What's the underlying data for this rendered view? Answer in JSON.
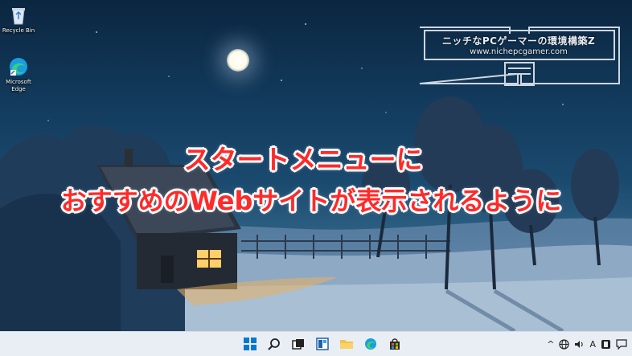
{
  "desktop": {
    "icons": [
      {
        "label": "Recycle Bin"
      },
      {
        "label": "Microsoft Edge"
      }
    ]
  },
  "overlay": {
    "line1": "スタートメニューに",
    "line2": "おすすめのWebサイトが表示されるように"
  },
  "watermark": {
    "title": "ニッチなPCゲーマーの環境構築Z",
    "url": "www.nichepcgamer.com"
  },
  "taskbar": {
    "pinned": [
      "start-icon",
      "search-icon",
      "task-view-icon",
      "widgets-icon",
      "file-explorer-icon",
      "edge-icon",
      "store-icon"
    ],
    "tray": {
      "chevron": "^",
      "language": "A"
    }
  },
  "colors": {
    "caption": "#ff2a2a",
    "taskbar": "#e9eef5",
    "accent": "#0078d4"
  }
}
